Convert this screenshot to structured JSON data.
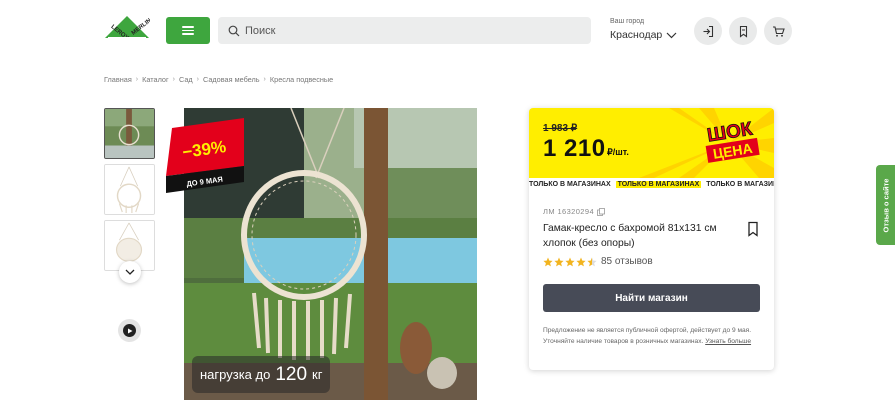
{
  "header": {
    "logo_text": "LEROY MERLIN",
    "search_placeholder": "Поиск",
    "city_label": "Ваш город",
    "city_value": "Краснодар",
    "icons": [
      "login-icon",
      "bookmark-icon",
      "cart-icon"
    ]
  },
  "breadcrumb": [
    "Главная",
    "Каталог",
    "Сад",
    "Садовая мебель",
    "Кресла подвесные"
  ],
  "gallery": {
    "thumbnail_count": 3,
    "discount_percent": "−39%",
    "discount_until": "ДО 9 МАЯ",
    "load_prefix": "нагрузка до",
    "load_value": "120",
    "load_unit": "кг"
  },
  "product": {
    "old_price": "1 983 ₽",
    "price": "1 210",
    "price_unit": "₽/шт.",
    "promo_label_line1": "ШОК",
    "promo_label_line2": "ЦЕНА",
    "ticker_text": "ТОЛЬКО В МАГАЗИНАХ",
    "sku": "ЛМ 16320294",
    "title": "Гамак-кресло с бахромой 81x131 см хлопок (без опоры)",
    "rating": 4.5,
    "reviews": "85 отзывов",
    "find_store_button": "Найти магазин",
    "disclaimer": "Предложение не является публичной офертой, действует до 9 мая. Уточняйте наличие товаров в розничных магазинах.",
    "disclaimer_link": "Узнать больше"
  },
  "feedback_tab": "Отзыв о сайте",
  "colors": {
    "brand_green": "#3ea63e",
    "promo_yellow": "#ffee00",
    "discount_red": "#e3001b",
    "button_dark": "#474b57"
  }
}
